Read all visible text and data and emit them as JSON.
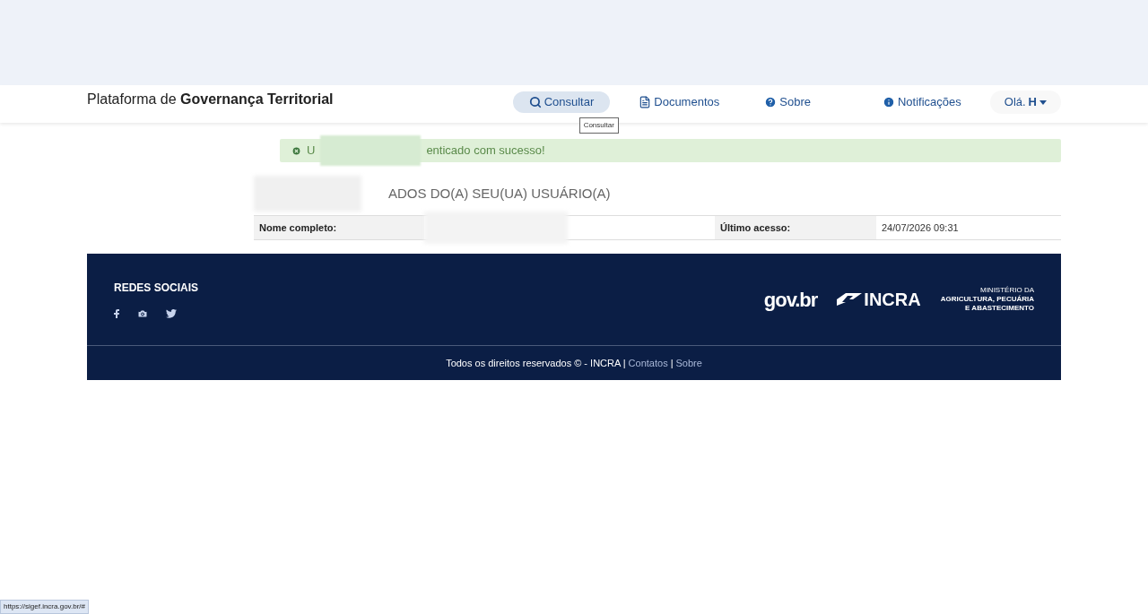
{
  "header": {
    "title_prefix": "Plataforma de",
    "title_bold": "Governança Territorial"
  },
  "nav": [
    {
      "label": "Consultar",
      "selected": true
    },
    {
      "label": "Documentos",
      "selected": false
    },
    {
      "label": "Sobre",
      "selected": false
    },
    {
      "label": "Notificações",
      "selected": false
    }
  ],
  "user_menu": {
    "greeting": "Olá.",
    "initial": "H"
  },
  "tooltip": "Consultar",
  "alert": {
    "text_start": "U",
    "text_end": "enticado com sucesso!"
  },
  "section_title": "ADOS DO(A) SEU(UA) USUÁRIO(A)",
  "user_table": [
    {
      "label": "Nome completo:"
    },
    {
      "label": "Último acesso:",
      "value": "24/07/2026 09:31"
    }
  ],
  "footer": {
    "social_title": "REDES SOCIAIS",
    "logos": {
      "govbr": "gov.br",
      "incra": "INCRA",
      "ministry": [
        "MINISTÉRIO DA",
        "AGRICULTURA, PECUÁRIA",
        "E ABASTECIMENTO"
      ]
    },
    "copyright": "Todos os direitos reservados © - INCRA |",
    "links": [
      "Contatos",
      "Sobre"
    ],
    "separator": "|"
  },
  "status_bar": "https://sigef.incra.gov.br/#"
}
